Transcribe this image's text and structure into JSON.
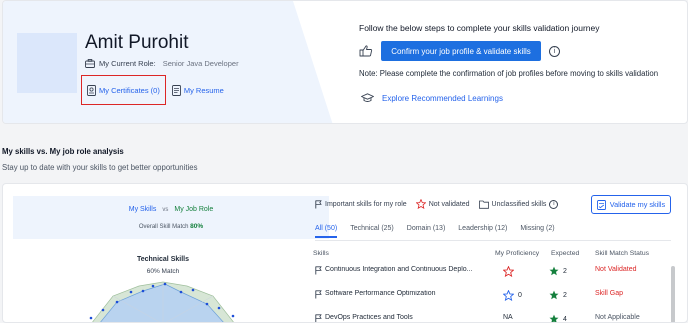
{
  "profile": {
    "name": "Amit Purohit",
    "role_label": "My Current Role:",
    "role_value": "Senior Java Developer",
    "certificates_link": "My Certificates (0)",
    "resume_link": "My Resume"
  },
  "steps": {
    "title": "Follow the below steps to complete your skills validation journey",
    "confirm_button": "Confirm your job profile & validate skills",
    "note": "Note: Please complete the confirmation of job profiles before moving to skills validation",
    "explore_link": "Explore Recommended Learnings"
  },
  "analysis": {
    "title": "My skills vs. My job role analysis",
    "subtitle": "Stay up to date with your skills to get better opportunities",
    "my_skills": "My Skills",
    "vs": "vs",
    "my_job_role": "My Job Role",
    "overall_label": "Overall Skill Match",
    "overall_value": "80%",
    "technical_title": "Technical Skills",
    "technical_match": "60% Match"
  },
  "legend": {
    "important": "Important skills for my role",
    "not_validated": "Not validated",
    "unclassified": "Unclassified skills",
    "validate_button": "Validate my skills"
  },
  "tabs": [
    "All (50)",
    "Technical (25)",
    "Domain (13)",
    "Leadership (12)",
    "Missing (2)"
  ],
  "table": {
    "headers": {
      "skills": "Skills",
      "proficiency": "My Proficiency",
      "expected": "Expected",
      "status": "Skill Match Status"
    },
    "rows": [
      {
        "skill": "Continuous Integration and Continuous Deplo...",
        "proficiency": "",
        "expected": "2",
        "status": "Not Validated",
        "status_color": "#dc2626",
        "prof_icon": "outline-star-red"
      },
      {
        "skill": "Software Performance Optimization",
        "proficiency": "0",
        "expected": "2",
        "status": "Skill Gap",
        "status_color": "#dc2626",
        "prof_icon": "outline-star-blue"
      },
      {
        "skill": "DevOps Practices and Tools",
        "proficiency": "NA",
        "expected": "4",
        "status": "Not Applicable",
        "status_color": "#4b5563",
        "prof_icon": "none"
      }
    ]
  },
  "colors": {
    "accent": "#1d6fe0",
    "green": "#15803d",
    "red": "#dc2626"
  }
}
